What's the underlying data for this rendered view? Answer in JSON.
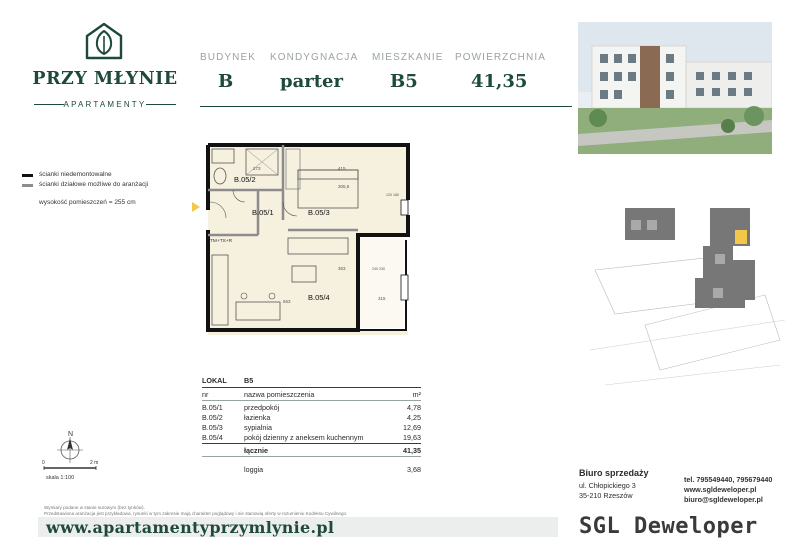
{
  "logo": {
    "name": "PRZY MŁYNIE",
    "sub": "APARTAMENTY"
  },
  "header": {
    "fields": [
      {
        "label": "BUDYNEK",
        "value": "B"
      },
      {
        "label": "KONDYGNACJA",
        "value": "parter"
      },
      {
        "label": "MIESZKANIE",
        "value": "B5"
      },
      {
        "label": "POWIERZCHNIA",
        "value": "41,35"
      }
    ]
  },
  "legend": {
    "load_walls": "ścianki niedemontowalne",
    "partition_walls": "ścianki działowe możliwe do aranżacji",
    "height_note": "wysokość pomieszczeń = 255 cm",
    "colors": {
      "load": "#111111",
      "partition": "#8c8c8c"
    }
  },
  "plan": {
    "rooms": [
      "B.05/1",
      "B.05/2",
      "B.05/3",
      "B.05/4"
    ],
    "dims": {
      "bath_w": "273",
      "bed_w": "415",
      "bed_d": "305,5",
      "living_w": "563",
      "living_d": "353",
      "loggia_w": "315",
      "window1": "120 180",
      "window2": "240 230",
      "entrance_note": "TM+TS+R"
    }
  },
  "table": {
    "header": {
      "code": "LOKAL",
      "unit": "B5"
    },
    "columns": {
      "nr": "nr",
      "name": "nazwa pomieszczenia",
      "unit": "m²"
    },
    "rows": [
      {
        "nr": "B.05/1",
        "name": "przedpokój",
        "area": "4,78"
      },
      {
        "nr": "B.05/2",
        "name": "łazienka",
        "area": "4,25"
      },
      {
        "nr": "B.05/3",
        "name": "sypialnia",
        "area": "12,69"
      },
      {
        "nr": "B.05/4",
        "name": "pokój dzienny z aneksem kuchennym",
        "area": "19,63"
      }
    ],
    "total": {
      "name": "łącznie",
      "area": "41,35"
    },
    "loggia": {
      "name": "loggia",
      "area": "3,68"
    }
  },
  "north": {
    "letter": "N",
    "scale_start": "0",
    "scale_end": "2 m",
    "scale": "skala 1:100"
  },
  "office": {
    "title": "Biuro sprzedaży",
    "street": "ul. Chłopickiego 3",
    "city": "35-210 Rzeszów"
  },
  "contact": {
    "phone": "tel. 795549440, 795679440",
    "web": "www.sgldeweloper.pl",
    "email": "biuro@sgldeweloper.pl"
  },
  "disclaimer": [
    "Wymiary podane w stanie surowym (bez tynków).",
    "Przedstawiona aranżacja jest przykładowa, rysunki w tym zakresie mają charakter poglądowy i nie stanowią oferty w rozumieniu Kodeksu Cywilnego."
  ],
  "website": "www.apartamentyprzymlynie.pl",
  "brand": "SGL Deweloper",
  "colors": {
    "brand_green": "#1e4a3a",
    "highlight": "#f2c84b",
    "floor": "#f6f0df"
  }
}
